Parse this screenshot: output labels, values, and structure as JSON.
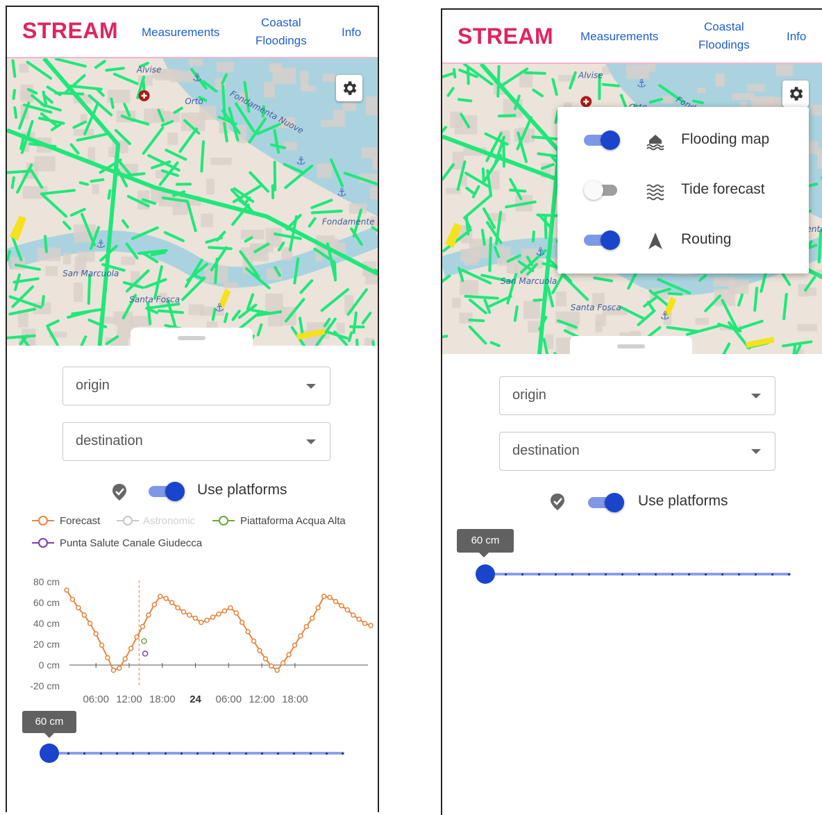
{
  "app": {
    "brand": "STREAM",
    "nav": {
      "measurements": "Measurements",
      "coastal_line1": "Coastal",
      "coastal_line2": "Floodings",
      "info": "Info"
    }
  },
  "map": {
    "labels": [
      "Alvise",
      "Orto",
      "Fondamenta Nuove",
      "San Marcuola",
      "Santa Fosca",
      "Fondamente Nove"
    ]
  },
  "form": {
    "origin": "origin",
    "destination": "destination",
    "use_platforms": "Use platforms",
    "use_platforms_on": true
  },
  "legend": {
    "items": [
      {
        "label": "Forecast",
        "color": "#e8833a"
      },
      {
        "label": "Astronomic",
        "color": "#c8c8c8"
      },
      {
        "label": "Piattaforma Acqua Alta",
        "color": "#6aaa3a"
      },
      {
        "label": "Punta Salute Canale Giudecca",
        "color": "#7b3fb3"
      }
    ]
  },
  "chart_data": {
    "type": "line",
    "y_ticks": [
      "80 cm",
      "60 cm",
      "40 cm",
      "20 cm",
      "0 cm",
      "-20 cm"
    ],
    "x_ticks": [
      "06:00",
      "12:00",
      "18:00",
      "24",
      "06:00",
      "12:00",
      "18:00"
    ],
    "ylim": [
      -20,
      80
    ],
    "series": [
      {
        "name": "Forecast",
        "color": "#e8833a",
        "values": [
          72,
          63,
          55,
          48,
          40,
          30,
          19,
          7,
          -5,
          -3,
          6,
          16,
          27,
          37,
          48,
          58,
          66,
          64,
          60,
          55,
          51,
          48,
          45,
          41,
          43,
          46,
          49,
          52,
          55,
          50,
          41,
          32,
          23,
          14,
          6,
          -1,
          -5,
          2,
          10,
          19,
          28,
          37,
          45,
          55,
          66,
          65,
          61,
          57,
          53,
          48,
          44,
          40,
          38
        ]
      },
      {
        "name": "Piattaforma Acqua Alta",
        "color": "#6aaa3a",
        "x": 13.5,
        "y": 23
      },
      {
        "name": "Punta Salute Canale Giudecca",
        "color": "#7b3fb3",
        "x": 13.7,
        "y": 11
      }
    ],
    "now_marker_hour": 12.6
  },
  "slider": {
    "value_label": "60 cm",
    "value": 60,
    "min": 60,
    "max": 300
  },
  "settings_menu": {
    "items": [
      {
        "label": "Flooding map",
        "icon": "flood-house-icon",
        "enabled": true
      },
      {
        "label": "Tide forecast",
        "icon": "waves-icon",
        "enabled": false
      },
      {
        "label": "Routing",
        "icon": "navigation-arrow-icon",
        "enabled": true
      }
    ]
  },
  "colors": {
    "brand": "#e0245e",
    "accent": "#1a44cc",
    "link": "#1f5fcf",
    "streets": "#1ee87a"
  }
}
